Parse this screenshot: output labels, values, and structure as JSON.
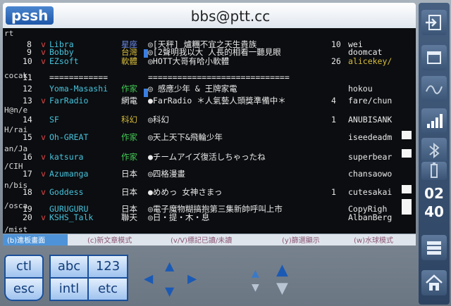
{
  "app": {
    "name": "pssh",
    "window_title": "bbs@ptt.cc"
  },
  "side_labels": [
    "rt",
    "cocak",
    "H@n/e",
    "H/rai",
    "an/Ja",
    "/CIH",
    "n/bis",
    "/osca",
    "/mist"
  ],
  "boards": [
    {
      "num": "8",
      "mark": "v",
      "name": "Libra",
      "category": "星座",
      "desc": "◎[天秤] 爐糰不宜之天生貴族",
      "count": "10",
      "moderator": "wei"
    },
    {
      "num": "9",
      "mark": "v",
      "name": "Bobby",
      "category": "台灣",
      "desc": "◎[2聲明我以大 人長的相看一聽見眼",
      "count": "",
      "moderator": "doomcat"
    },
    {
      "num": "10",
      "mark": "v",
      "name": "EZsoft",
      "category": "軟體",
      "desc": "◎HOTT大哥有哈小軟體",
      "count": "26",
      "moderator": "alicekey/"
    },
    {
      "num": "11",
      "mark": "",
      "name": "============",
      "category": "",
      "desc": "=============================",
      "count": "",
      "moderator": ""
    },
    {
      "num": "12",
      "mark": "",
      "name": "Yoma-Masashi",
      "category": "作家",
      "desc": "◎ 感應少年 & 王牌家電",
      "count": "",
      "moderator": "hokou"
    },
    {
      "num": "13",
      "mark": "v",
      "name": "FarRadio",
      "category": "網電",
      "desc": "●FarRadio ＊人氣藝人頭獎準備中＊",
      "count": "4",
      "moderator": "fare/chun"
    },
    {
      "num": "14",
      "mark": "",
      "name": "SF",
      "category": "科幻",
      "desc": "◎科幻",
      "count": "1",
      "moderator": "ANUBISANK"
    },
    {
      "num": "15",
      "mark": "v",
      "name": "Oh-GREAT",
      "category": "作家",
      "desc": "◎天上天下&飛輪少年",
      "count": "",
      "moderator": "iseedeadm"
    },
    {
      "num": "16",
      "mark": "v",
      "name": "katsura",
      "category": "作家",
      "desc": "●チームアイズ復活しちゃったね",
      "count": "",
      "moderator": "superbear"
    },
    {
      "num": "17",
      "mark": "v",
      "name": "Azumanga",
      "category": "日本",
      "desc": "◎四格漫畫",
      "count": "",
      "moderator": "chansaowo"
    },
    {
      "num": "18",
      "mark": "v",
      "name": "Goddess",
      "category": "日本",
      "desc": "●めめっ 女神さまっ",
      "count": "1",
      "moderator": "cutesakai"
    },
    {
      "num": "19",
      "mark": "",
      "name": "GURUGURU",
      "category": "日本",
      "desc": "◎電子魔物糊搞抱第三集新帥呼叫上市",
      "count": "",
      "moderator": "CopyRigh"
    },
    {
      "num": "20",
      "mark": "v",
      "name": "KSHS_Talk",
      "category": "聯天",
      "desc": "◎日・提・木・息",
      "count": "",
      "moderator": "AlbanBerg"
    }
  ],
  "menu": [
    {
      "label": "(b)進板畫面",
      "active": true
    },
    {
      "label": "(c)新文章模式",
      "active": false
    },
    {
      "label": "(v/V)標記已讀/未讀",
      "active": false
    },
    {
      "label": "(y)篩選顯示",
      "active": false
    },
    {
      "label": "(w)水球模式",
      "active": false
    }
  ],
  "keys": {
    "ctl": "ctl",
    "esc": "esc",
    "abc": "abc",
    "num": "123",
    "intl": "intl",
    "etc": "etc"
  },
  "arrows": {
    "up": "▲",
    "down": "▼",
    "left": "◀",
    "right": "▶",
    "page_up": "▲",
    "page_down": "▼"
  },
  "sidebar": {
    "icons": [
      "logout-icon",
      "window-icon",
      "wave-icon",
      "signal-icon",
      "bluetooth-icon",
      "battery-icon",
      "keyboard-icon",
      "home-icon"
    ],
    "clock_hour": "02",
    "clock_minute": "40"
  },
  "colors": {
    "accent": "#4e93d8",
    "terminal_bg": "#0b0d10",
    "key_border": "#1a4f9a"
  }
}
